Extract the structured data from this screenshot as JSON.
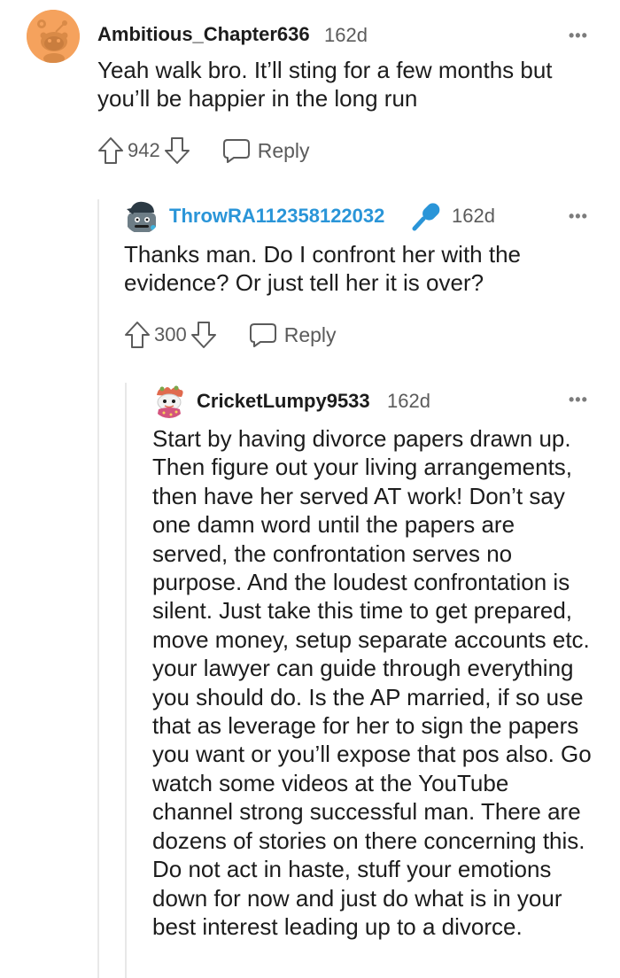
{
  "comments": [
    {
      "username": "Ambitious_Chapter636",
      "age": "162d",
      "body": "Yeah walk bro. It’ll sting for a few months but you’ll be happier in the long run",
      "score": "942",
      "reply_label": "Reply",
      "more_label": "•••"
    },
    {
      "username": "ThrowRA112358122032",
      "age": "162d",
      "body": "Thanks man. Do I confront her with the evidence? Or just tell her it is over?",
      "score": "300",
      "reply_label": "Reply",
      "more_label": "•••",
      "badge_icon": "microphone-icon",
      "username_color": "#2a95d8"
    },
    {
      "username": "CricketLumpy9533",
      "age": "162d",
      "body": "Start by having divorce papers drawn up. Then figure out your living arrangements, then have her served AT work! Don’t say one damn word until the papers are served, the confrontation serves no purpose. And the loudest confrontation is silent. Just take this time to get prepared, move money, setup separate accounts etc. your lawyer can guide through everything you should do. Is the AP married, if so use that as leverage for her to sign the papers you want or you’ll expose that pos also. Go watch some videos at the YouTube channel strong successful man. There are dozens of stories on there concerning this. Do not act in haste, stuff your emotions down for now and just do what is in your best interest leading up to a divorce.",
      "more_label": "•••"
    }
  ]
}
